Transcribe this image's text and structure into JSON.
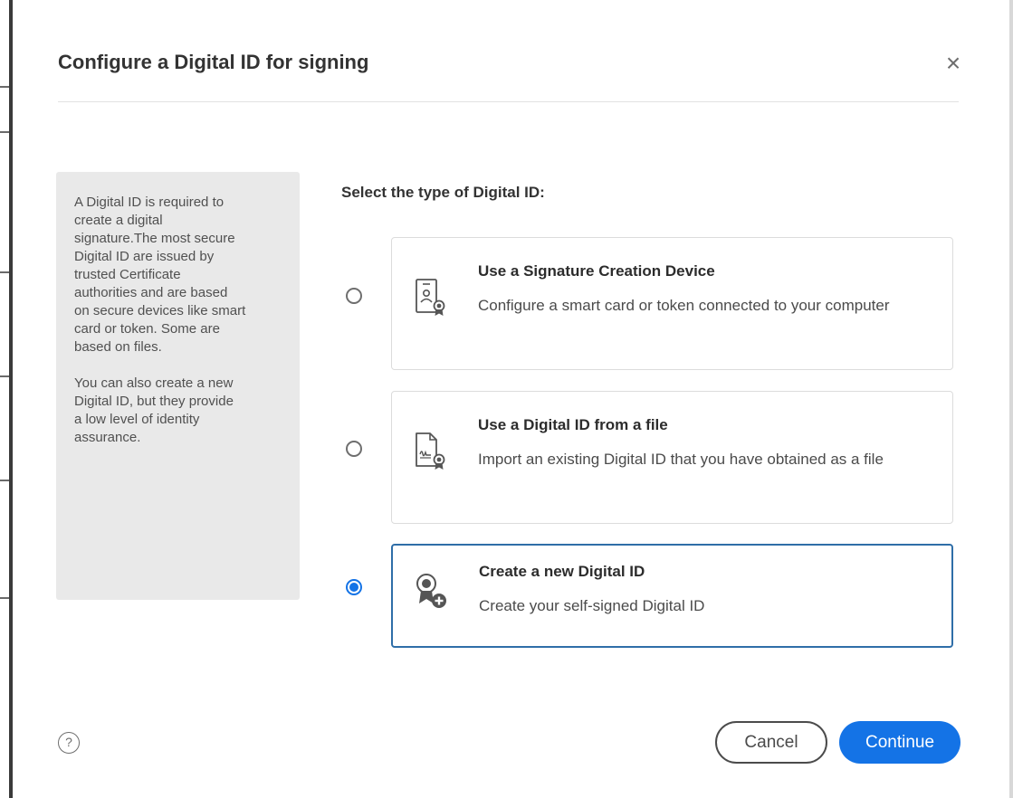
{
  "dialog": {
    "title": "Configure a Digital ID for signing",
    "close_icon": "close-icon"
  },
  "info_panel": {
    "paragraph_1": "A Digital ID is required to\ncreate a digital\nsignature.The most secure\nDigital ID are issued by\ntrusted Certificate\nauthorities and are based\non secure devices like smart\ncard or token. Some are\nbased on files.",
    "paragraph_2": "You can also create a new\nDigital ID, but they provide\na low level of identity\nassurance."
  },
  "selection": {
    "heading": "Select the type of Digital ID:",
    "selected_option": "Create a new Digital ID",
    "options": [
      {
        "title": "Use a Signature Creation Device",
        "description": "Configure a smart card or token connected to your computer",
        "icon": "smart-card-icon",
        "selected": false
      },
      {
        "title": "Use a Digital ID from a file",
        "description": "Import an existing Digital ID that you have obtained as a file",
        "icon": "certificate-file-icon",
        "selected": false
      },
      {
        "title": "Create a new Digital ID",
        "description": "Create your self-signed Digital ID",
        "icon": "new-certificate-icon",
        "selected": true
      }
    ]
  },
  "footer": {
    "help_icon": "help-icon",
    "help_symbol": "?",
    "cancel_label": "Cancel",
    "continue_label": "Continue"
  },
  "colors": {
    "accent": "#1473e6",
    "selected_border": "#2f6ea8",
    "info_panel_bg": "#e9e9e9"
  }
}
